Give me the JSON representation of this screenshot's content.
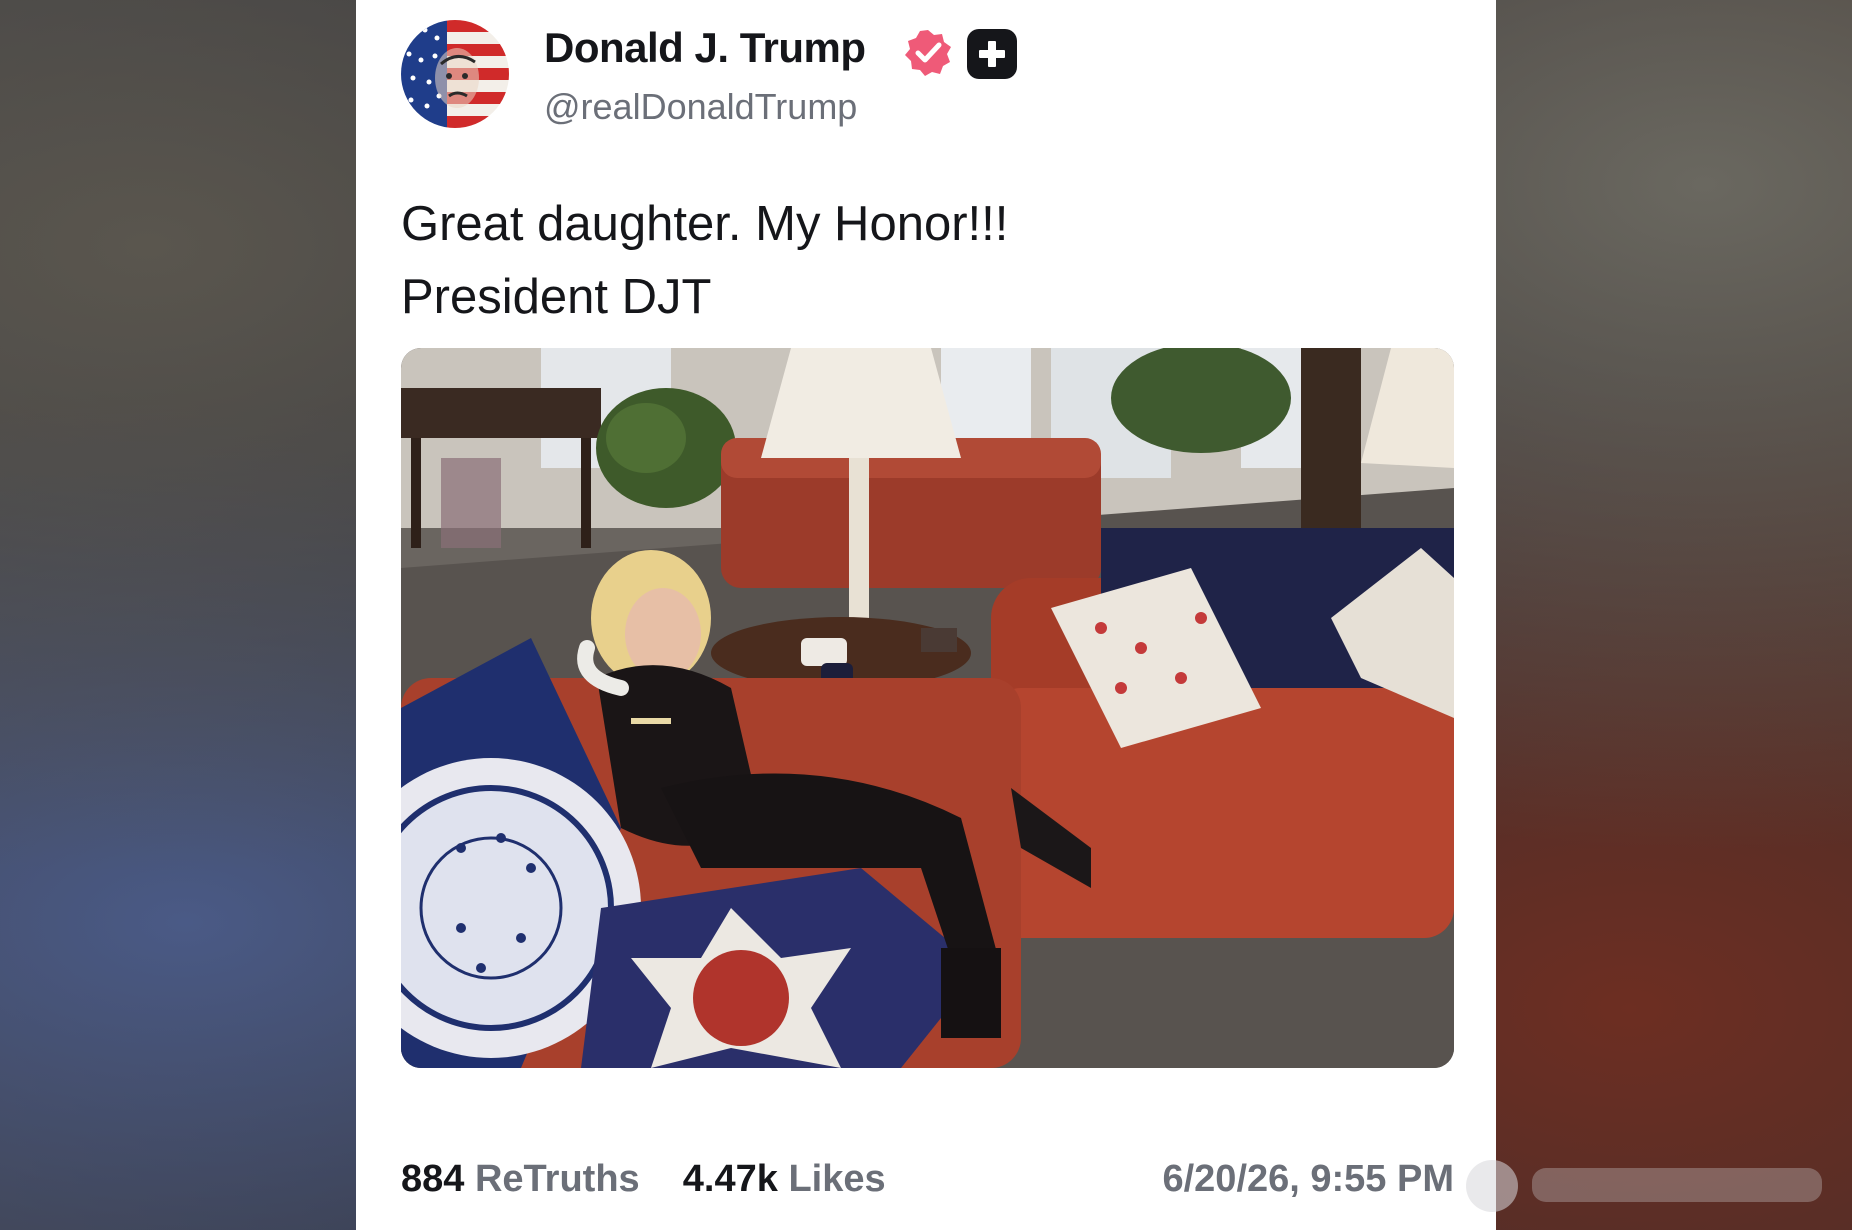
{
  "post": {
    "author": {
      "display_name": "Donald J. Trump",
      "handle": "@realDonaldTrump"
    },
    "text": "Great daughter. My Honor!!! President DJT",
    "stats": {
      "retruths_count": "884",
      "retruths_label": "ReTruths",
      "likes_count": "4.47k",
      "likes_label": "Likes"
    },
    "timestamp": "6/20/26, 9:55 PM"
  },
  "colors": {
    "verified_badge": "#ef5a78",
    "primary_text": "#15161a",
    "secondary_text": "#6b6f78",
    "card_background": "#ffffff"
  },
  "icons": {
    "verified": "verified-badge-icon",
    "plus": "plus-badge-icon"
  }
}
